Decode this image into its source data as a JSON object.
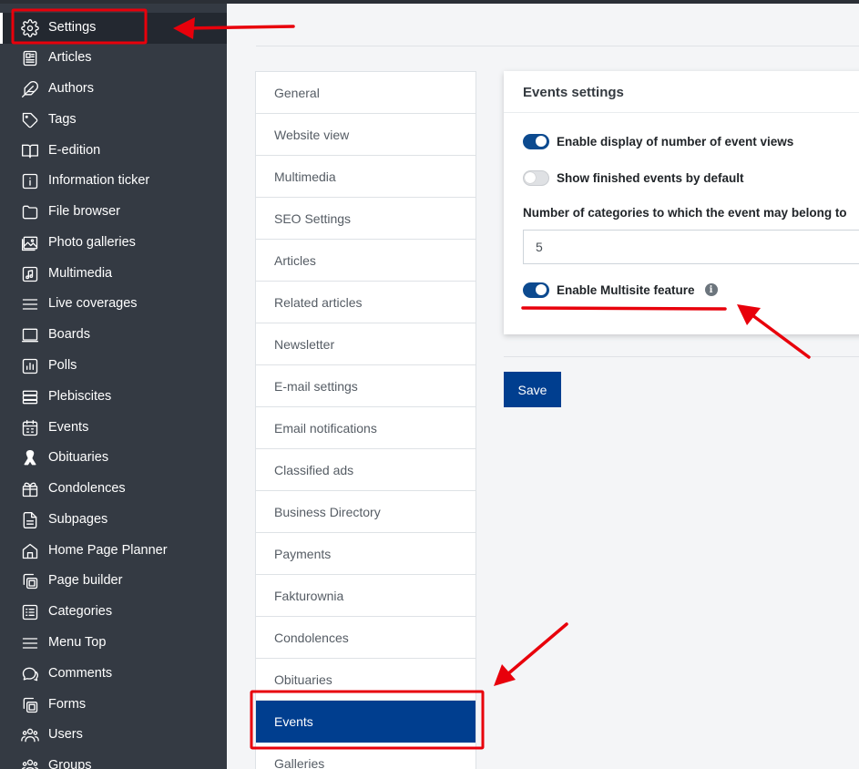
{
  "sidebar": {
    "items": [
      {
        "label": "Settings",
        "icon": "gear-icon",
        "active": true
      },
      {
        "label": "Articles",
        "icon": "newspaper-icon"
      },
      {
        "label": "Authors",
        "icon": "feather-icon"
      },
      {
        "label": "Tags",
        "icon": "tag-icon"
      },
      {
        "label": "E-edition",
        "icon": "book-icon"
      },
      {
        "label": "Information ticker",
        "icon": "info-square-icon"
      },
      {
        "label": "File browser",
        "icon": "folder-icon"
      },
      {
        "label": "Photo galleries",
        "icon": "images-icon"
      },
      {
        "label": "Multimedia",
        "icon": "music-file-icon"
      },
      {
        "label": "Live coverages",
        "icon": "list-lines-icon"
      },
      {
        "label": "Boards",
        "icon": "board-icon"
      },
      {
        "label": "Polls",
        "icon": "bar-chart-icon"
      },
      {
        "label": "Plebiscites",
        "icon": "layers-icon"
      },
      {
        "label": "Events",
        "icon": "calendar-icon"
      },
      {
        "label": "Obituaries",
        "icon": "ribbon-icon"
      },
      {
        "label": "Condolences",
        "icon": "gift-icon"
      },
      {
        "label": "Subpages",
        "icon": "file-text-icon"
      },
      {
        "label": "Home Page Planner",
        "icon": "home-icon"
      },
      {
        "label": "Page builder",
        "icon": "copy-icon"
      },
      {
        "label": "Categories",
        "icon": "list-box-icon"
      },
      {
        "label": "Menu Top",
        "icon": "menu-icon"
      },
      {
        "label": "Comments",
        "icon": "chat-icon"
      },
      {
        "label": "Forms",
        "icon": "forms-icon"
      },
      {
        "label": "Users",
        "icon": "users-icon"
      },
      {
        "label": "Groups",
        "icon": "groups-icon"
      }
    ]
  },
  "subnav": {
    "items": [
      {
        "label": "General"
      },
      {
        "label": "Website view"
      },
      {
        "label": "Multimedia"
      },
      {
        "label": "SEO Settings"
      },
      {
        "label": "Articles"
      },
      {
        "label": "Related articles"
      },
      {
        "label": "Newsletter"
      },
      {
        "label": "E-mail settings"
      },
      {
        "label": "Email notifications"
      },
      {
        "label": "Classified ads"
      },
      {
        "label": "Business Directory"
      },
      {
        "label": "Payments"
      },
      {
        "label": "Fakturownia"
      },
      {
        "label": "Condolences"
      },
      {
        "label": "Obituaries"
      },
      {
        "label": "Events",
        "active": true
      },
      {
        "label": "Galleries"
      }
    ]
  },
  "events_settings": {
    "title": "Events settings",
    "toggle_views": {
      "label": "Enable display of number of event views",
      "on": true
    },
    "toggle_finished": {
      "label": "Show finished events by default",
      "on": false
    },
    "categories_label": "Number of categories to which the event may belong to",
    "categories_value": "5",
    "toggle_multisite": {
      "label": "Enable Multisite feature",
      "on": true
    },
    "info_glyph": "i"
  },
  "save_label": "Save",
  "colors": {
    "sidebar_bg": "#343a43",
    "accent": "#003e8f",
    "annotation": "#e8000b"
  }
}
